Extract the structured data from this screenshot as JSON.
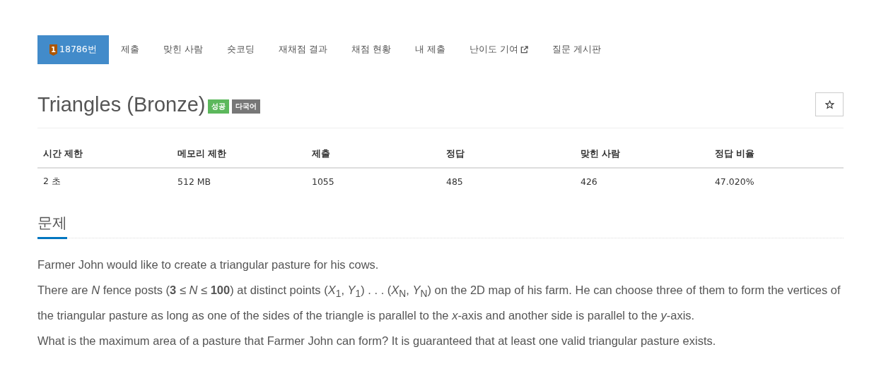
{
  "tabs": [
    {
      "label": "18786번",
      "tier": "1",
      "selected": true
    },
    {
      "label": "제출",
      "selected": false
    },
    {
      "label": "맞힌 사람",
      "selected": false
    },
    {
      "label": "숏코딩",
      "selected": false
    },
    {
      "label": "재채점 결과",
      "selected": false
    },
    {
      "label": "채점 현황",
      "selected": false
    },
    {
      "label": "내 제출",
      "selected": false
    },
    {
      "label": "난이도 기여",
      "external": true,
      "selected": false
    },
    {
      "label": "질문 게시판",
      "selected": false
    }
  ],
  "problem": {
    "title": "Triangles (Bronze)",
    "labels": [
      {
        "text": "성공",
        "color": "#5cb85c"
      },
      {
        "text": "다국어",
        "color": "#777777"
      }
    ],
    "starred": false
  },
  "info_table": {
    "columns": [
      "시간 제한",
      "메모리 제한",
      "제출",
      "정답",
      "맞힌 사람",
      "정답 비율"
    ],
    "rows": [
      [
        "2 초",
        "512 MB",
        "1055",
        "485",
        "426",
        "47.020%"
      ]
    ]
  },
  "section": {
    "heading": "문제",
    "paragraphs": [
      "Farmer John would like to create a triangular pasture for his cows.",
      "There are *N* fence posts (**3** ≤ *N* ≤ **100**) at distinct points (*X*$_{1}$, *Y*$_{1}$) . . . (*X*$_{N}$, *Y*$_{N}$) on the 2D map of his farm. He can choose three of them to form the vertices of the triangular pasture as long as one of the sides of the triangle is parallel to the *x*-axis and another side is parallel to the *y*-axis.",
      "What is the maximum area of a pasture that Farmer John can form? It is guaranteed that at least one valid triangular pasture exists."
    ]
  }
}
